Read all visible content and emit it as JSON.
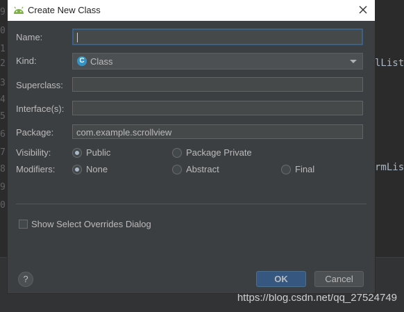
{
  "background": {
    "line_numbers": [
      "9",
      "0",
      "1",
      "2",
      "3",
      "4",
      "5",
      "6",
      "7",
      "8",
      "9",
      "0"
    ],
    "code_fragment_1": "lListe",
    "code_fragment_2": "rmList"
  },
  "dialog": {
    "title": "Create New Class",
    "fields": {
      "name_label": "Name:",
      "name_value": "",
      "kind_label": "Kind:",
      "kind_value": "Class",
      "kind_icon": "C",
      "superclass_label": "Superclass:",
      "superclass_value": "",
      "interfaces_label": "Interface(s):",
      "interfaces_value": "",
      "package_label": "Package:",
      "package_value": "com.example.scrollview"
    },
    "visibility": {
      "label": "Visibility:",
      "options": [
        {
          "label": "Public",
          "selected": true
        },
        {
          "label": "Package Private",
          "selected": false
        }
      ]
    },
    "modifiers": {
      "label": "Modifiers:",
      "options": [
        {
          "label": "None",
          "selected": true
        },
        {
          "label": "Abstract",
          "selected": false
        },
        {
          "label": "Final",
          "selected": false
        }
      ]
    },
    "overrides_checkbox_label": "Show Select Overrides Dialog",
    "help_label": "?",
    "ok_label": "OK",
    "cancel_label": "Cancel"
  },
  "watermark": "https://blog.csdn.net/qq_27524749",
  "colors": {
    "dialog_bg": "#3c3f41",
    "accent": "#365880",
    "focus_border": "#3d6185",
    "class_icon": "#3592c4"
  }
}
